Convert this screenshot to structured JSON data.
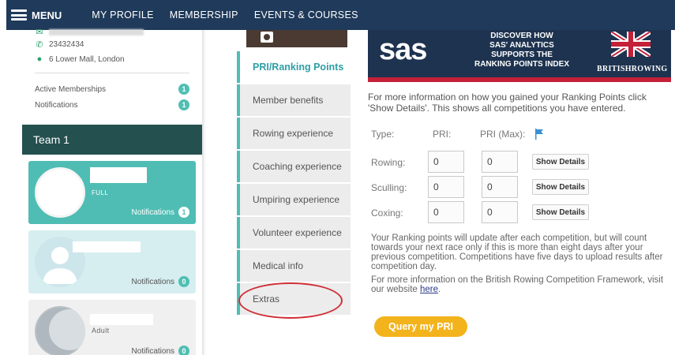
{
  "nav": {
    "menu_label": "MENU",
    "links": [
      "MY PROFILE",
      "MEMBERSHIP",
      "EVENTS & COURSES"
    ]
  },
  "profile": {
    "phone": "23432434",
    "address": "6 Lower Mall, London",
    "active_memberships_label": "Active Memberships",
    "active_memberships_count": "1",
    "notifications_label": "Notifications",
    "notifications_count": "1"
  },
  "team": {
    "title": "Team 1",
    "cards": [
      {
        "subtitle": "FULL",
        "notif_label": "Notifications",
        "notif_count": "1"
      },
      {
        "subtitle": "",
        "notif_label": "Notifications",
        "notif_count": "0"
      },
      {
        "subtitle": "Adult",
        "notif_label": "Notifications",
        "notif_count": "0"
      }
    ]
  },
  "tabs": [
    {
      "label": "PRI/Ranking Points",
      "active": true
    },
    {
      "label": "Member benefits",
      "active": false
    },
    {
      "label": "Rowing experience",
      "active": false
    },
    {
      "label": "Coaching experience",
      "active": false
    },
    {
      "label": "Umpiring experience",
      "active": false
    },
    {
      "label": "Volunteer experience",
      "active": false
    },
    {
      "label": "Medical info",
      "active": false
    },
    {
      "label": "Extras",
      "active": false
    }
  ],
  "banner": {
    "logo_text": "sas",
    "line1": "DISCOVER HOW",
    "line2": "SAS' ANALYTICS",
    "line3": "SUPPORTS THE",
    "line4": "RANKING POINTS INDEX",
    "partner": "BRITISHROWING"
  },
  "pri": {
    "intro": "For more information on how you gained your Ranking Points click 'Show Details'. This shows all competitions you have entered.",
    "header_type": "Type:",
    "header_pri": "PRI:",
    "header_pri_max": "PRI (Max):",
    "rows": [
      {
        "type": "Rowing:",
        "pri": "0",
        "pri_max": "0",
        "button": "Show Details"
      },
      {
        "type": "Sculling:",
        "pri": "0",
        "pri_max": "0",
        "button": "Show Details"
      },
      {
        "type": "Coxing:",
        "pri": "0",
        "pri_max": "0",
        "button": "Show Details"
      }
    ],
    "update_note": "Your Ranking points will update after each competition, but will count towards your next race only if this is more than eight days after your previous competition. Competitions have five days to upload results after competition day.",
    "framework_prefix": "For more information on the British Rowing Competition Framework, visit our website ",
    "framework_link": "here",
    "framework_suffix": ".",
    "query_button": "Query my PRI"
  },
  "colors": {
    "nav_bg": "#1f3a5a",
    "team_bar": "#24504f",
    "teal": "#4fbdb4",
    "banner_bg": "#1e3350",
    "banner_stripe": "#c4203a",
    "query_button": "#f3b31c",
    "highlight_ring": "#cf2f36"
  }
}
